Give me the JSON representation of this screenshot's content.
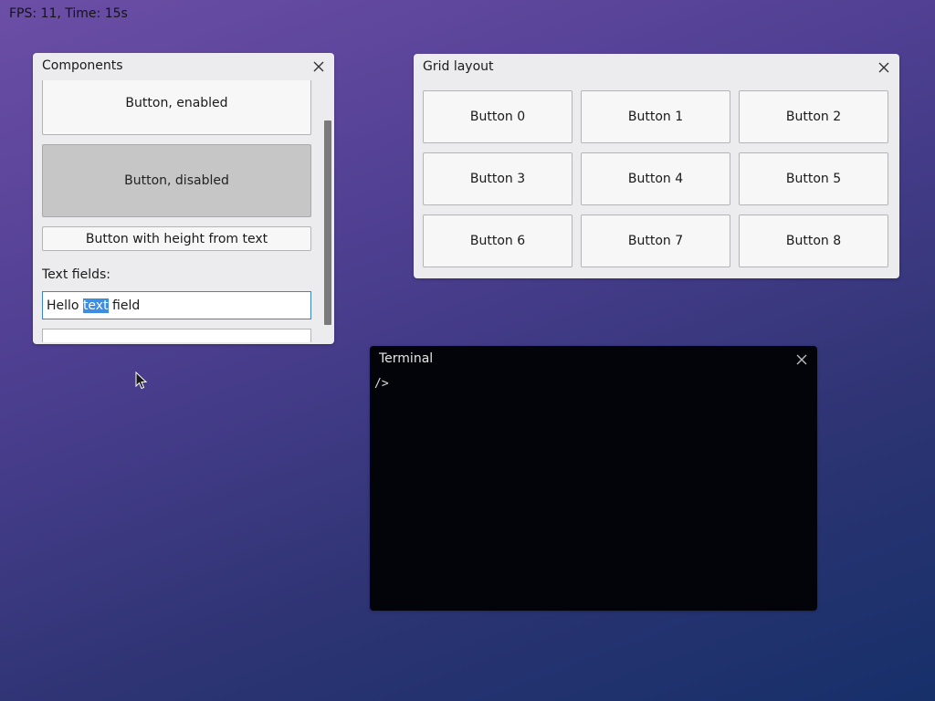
{
  "status": {
    "fps_text": "FPS: 11, Time: 15s"
  },
  "components_window": {
    "title": "Components",
    "button_enabled": "Button, enabled",
    "button_disabled": "Button, disabled",
    "button_text_height": "Button with height from text",
    "text_fields_label": "Text fields:",
    "text_field_before": "Hello ",
    "text_field_selected": "text",
    "text_field_after": " field",
    "second_text_field_value": ""
  },
  "grid_window": {
    "title": "Grid layout",
    "buttons": [
      "Button 0",
      "Button 1",
      "Button 2",
      "Button 3",
      "Button 4",
      "Button 5",
      "Button 6",
      "Button 7",
      "Button 8"
    ]
  },
  "terminal_window": {
    "title": "Terminal",
    "prompt": "/>"
  },
  "icons": [
    "close-icon",
    "mouse-pointer-icon"
  ],
  "colors": {
    "window_background": "#ecebee",
    "selection": "#3d8ee0",
    "focus_border": "#3d84cf",
    "terminal_background": "#03040a"
  }
}
